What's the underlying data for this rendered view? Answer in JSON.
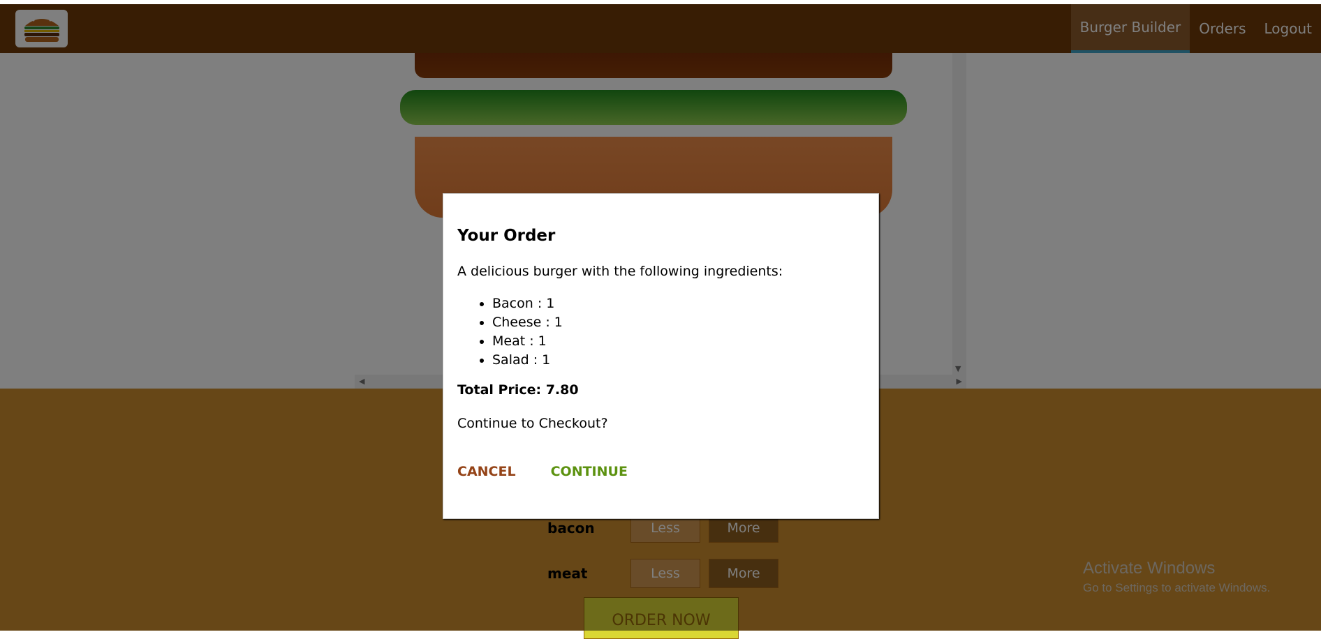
{
  "toolbar": {
    "logo_alt": "burger-logo",
    "nav": [
      {
        "label": "Burger Builder",
        "active": true
      },
      {
        "label": "Orders",
        "active": false
      },
      {
        "label": "Logout",
        "active": false
      }
    ]
  },
  "controls": [
    {
      "label": "bacon",
      "less": "Less",
      "more": "More"
    },
    {
      "label": "meat",
      "less": "Less",
      "more": "More"
    }
  ],
  "order_button": "ORDER NOW",
  "activate_windows": {
    "title": "Activate Windows",
    "subtitle": "Go to Settings to activate Windows."
  },
  "modal": {
    "title": "Your Order",
    "description": "A delicious burger with the following ingredients:",
    "ingredients": [
      "Bacon : 1",
      "Cheese : 1",
      "Meat : 1",
      "Salad : 1"
    ],
    "total_price": "Total Price: 7.80",
    "question": "Continue to Checkout?",
    "cancel": "CANCEL",
    "continue": "CONTINUE"
  },
  "colors": {
    "toolbar": "#703b09",
    "active_nav_border": "#40a4c8",
    "controls_bg": "#cf8f2e",
    "cancel": "#944317",
    "continue": "#5c9210"
  }
}
